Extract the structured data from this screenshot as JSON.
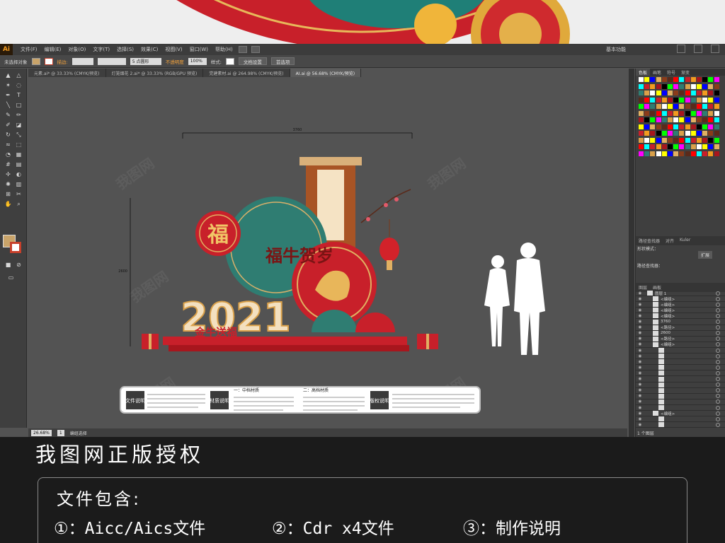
{
  "app": {
    "logo": "Ai",
    "workspace": "基本功能"
  },
  "menu": [
    "文件(F)",
    "编辑(E)",
    "对象(O)",
    "文字(T)",
    "选择(S)",
    "效果(C)",
    "视图(V)",
    "窗口(W)",
    "帮助(H)"
  ],
  "control_bar": {
    "selection_label": "未选择对象",
    "stroke_label": "描边:",
    "brush_value": "5 点圆形",
    "opacity_label": "不透明度",
    "opacity_value": "100%",
    "style_label": "样式:",
    "doc_setup": "文档设置",
    "preferences": "首选项"
  },
  "tabs": [
    "元素.ai* @ 33.33% (CMYK/预览)",
    "灯笼烟花 2.ai* @ 33.33% (RGB/GPU 预览)",
    "党建素材.ai @ 264.98% (CMYK/预览)",
    "AI.ai @ 56.68% (CMYK/预览)"
  ],
  "canvas": {
    "dimension_width": "3760",
    "dimension_height": "2600",
    "fu_char": "福",
    "vertical_text": "福牛贺岁",
    "year": "2021",
    "slogan": "金牛送福",
    "info_labels": [
      "文件说明",
      "材质说明",
      "版权说明"
    ],
    "mid_material": "一：中档材质",
    "high_material": "二：高档材质",
    "watermark": "我图网"
  },
  "status": {
    "zoom": "26.68%",
    "page": "1",
    "tool_label": "编组选择"
  },
  "panels": {
    "top_tabs": [
      "色板",
      "画笔",
      "符号",
      "渐变"
    ],
    "pathfinder_tabs": [
      "路径查找器",
      "对齐",
      "Kuler"
    ],
    "shape_mode": "形状模式：",
    "pathfinder_label": "路径查找器：",
    "expand_button": "扩展",
    "layers_tabs": [
      "图层",
      "画板"
    ],
    "layers_count": "1 个图层",
    "layers": [
      {
        "name": "图层 1",
        "level": 0
      },
      {
        "name": "<编组>",
        "level": 1
      },
      {
        "name": "<编组>",
        "level": 1
      },
      {
        "name": "<编组>",
        "level": 1
      },
      {
        "name": "<编组>",
        "level": 1
      },
      {
        "name": "3760",
        "level": 1
      },
      {
        "name": "<路径>",
        "level": 1
      },
      {
        "name": "2600",
        "level": 1
      },
      {
        "name": "<路径>",
        "level": 1
      },
      {
        "name": "<编组>",
        "level": 1
      },
      {
        "name": "",
        "level": 2
      },
      {
        "name": "",
        "level": 2
      },
      {
        "name": "",
        "level": 2
      },
      {
        "name": "",
        "level": 2
      },
      {
        "name": "",
        "level": 2
      },
      {
        "name": "",
        "level": 2
      },
      {
        "name": "",
        "level": 2
      },
      {
        "name": "",
        "level": 2
      },
      {
        "name": "",
        "level": 2
      },
      {
        "name": "",
        "level": 2
      },
      {
        "name": "",
        "level": 2
      },
      {
        "name": "<编组>",
        "level": 1
      },
      {
        "name": "",
        "level": 2
      },
      {
        "name": "",
        "level": 2
      }
    ]
  },
  "footer": {
    "title": "我图网正版授权",
    "includes_label": "文件包含:",
    "item1": "①：Aicc/Aics文件",
    "item2": "②：Cdr x4文件",
    "item3": "③：制作说明"
  },
  "colors": {
    "accent_red": "#c8202a",
    "teal": "#2f7d72",
    "gold": "#e0b062",
    "ui_dark": "#3f3f3f"
  }
}
